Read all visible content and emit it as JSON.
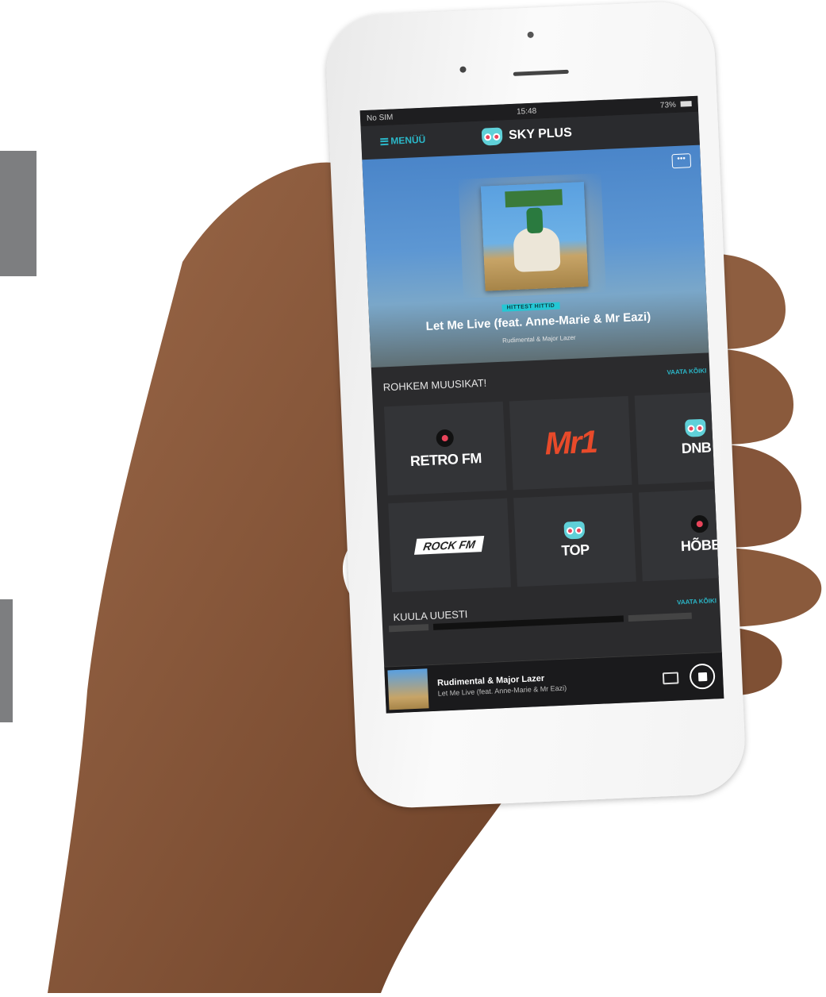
{
  "status_bar": {
    "carrier": "No SIM",
    "time": "15:48",
    "battery": "73%"
  },
  "app_bar": {
    "menu_label": "MENÜÜ",
    "brand_name": "SKY PLUS"
  },
  "now_playing_hero": {
    "more_label": "•••",
    "tag": "HITTEST HITTID",
    "song_title": "Let Me Live (feat. Anne-Marie & Mr Eazi)",
    "artist": "Rudimental & Major Lazer"
  },
  "more_music": {
    "title": "ROHKEM MUUSIKAT!",
    "link": "VAATA KÕIKI",
    "stations": [
      {
        "label": "RETRO FM"
      },
      {
        "label": "Mr1"
      },
      {
        "label": "DNB"
      },
      {
        "label": "ROCK FM"
      },
      {
        "label": "TOP"
      },
      {
        "label": "HÕBE"
      }
    ]
  },
  "listen_again": {
    "title": "KUULA UUESTI",
    "link": "VAATA KÕIKI"
  },
  "mini_player": {
    "artist": "Rudimental & Major Lazer",
    "song": "Let Me Live (feat. Anne-Marie & Mr Eazi)"
  },
  "colors": {
    "accent": "#2bb7c8",
    "screen_bg": "#2b2b2d",
    "owl_red": "#e8445a"
  }
}
